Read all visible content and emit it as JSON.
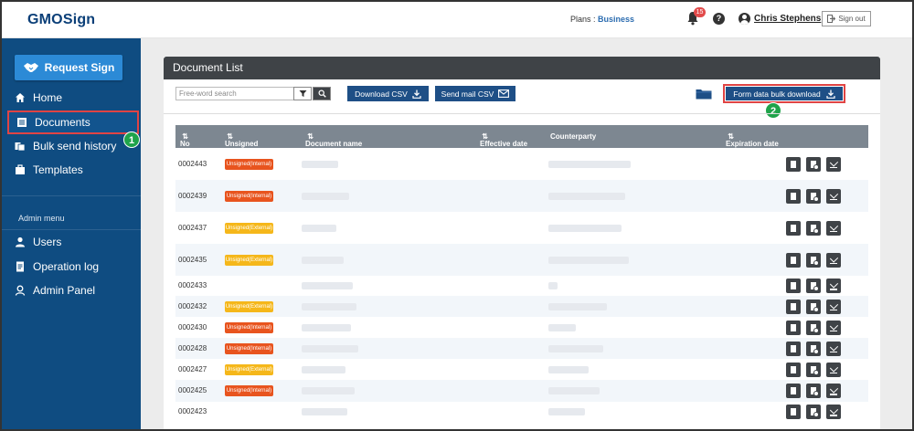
{
  "header": {
    "logo": "GMOSign",
    "plans_label": "Plans :",
    "plan_name": "Business",
    "notification_count": "15",
    "help": "?",
    "user_name": "Chris Stephens",
    "signout_label": "Sign out"
  },
  "sidebar": {
    "request_sign": "Request Sign",
    "items": [
      {
        "label": "Home",
        "icon": "home-icon"
      },
      {
        "label": "Documents",
        "icon": "document-icon"
      },
      {
        "label": "Bulk send history",
        "icon": "bulk-send-icon"
      },
      {
        "label": "Templates",
        "icon": "template-icon"
      }
    ],
    "admin_label": "Admin menu",
    "admin_items": [
      {
        "label": "Users",
        "icon": "user-icon"
      },
      {
        "label": "Operation log",
        "icon": "log-icon"
      },
      {
        "label": "Admin Panel",
        "icon": "admin-icon"
      }
    ],
    "step1": "1"
  },
  "main": {
    "title": "Document List",
    "search_placeholder": "Free-word search",
    "download_csv": "Download CSV",
    "send_mail_csv": "Send mail CSV",
    "bulk_download": "Form data bulk download",
    "step2": "2",
    "columns": {
      "no": "No",
      "unsigned": "Unsigned",
      "doc_name": "Document name",
      "effective": "Effective date",
      "counterparty": "Counterparty",
      "expiration": "Expiration date"
    },
    "rows": [
      {
        "no": "0002443",
        "tag": "Unsigned(Internal)",
        "type": "internal"
      },
      {
        "no": "0002439",
        "tag": "Unsigned(Internal)",
        "type": "internal"
      },
      {
        "no": "0002437",
        "tag": "Unsigned(External)",
        "type": "external"
      },
      {
        "no": "0002435",
        "tag": "Unsigned(External)",
        "type": "external"
      },
      {
        "no": "0002433",
        "tag": "",
        "type": ""
      },
      {
        "no": "0002432",
        "tag": "Unsigned(External)",
        "type": "external"
      },
      {
        "no": "0002430",
        "tag": "Unsigned(Internal)",
        "type": "internal"
      },
      {
        "no": "0002428",
        "tag": "Unsigned(Internal)",
        "type": "internal"
      },
      {
        "no": "0002427",
        "tag": "Unsigned(External)",
        "type": "external"
      },
      {
        "no": "0002425",
        "tag": "Unsigned(Internal)",
        "type": "internal"
      },
      {
        "no": "0002423",
        "tag": "",
        "type": ""
      }
    ]
  },
  "colors": {
    "sidebar": "#0f4c81",
    "accent": "#2c8ad6",
    "internal": "#e8541e",
    "external": "#f5b71a",
    "highlight": "#e04444",
    "step": "#1fa34a"
  }
}
